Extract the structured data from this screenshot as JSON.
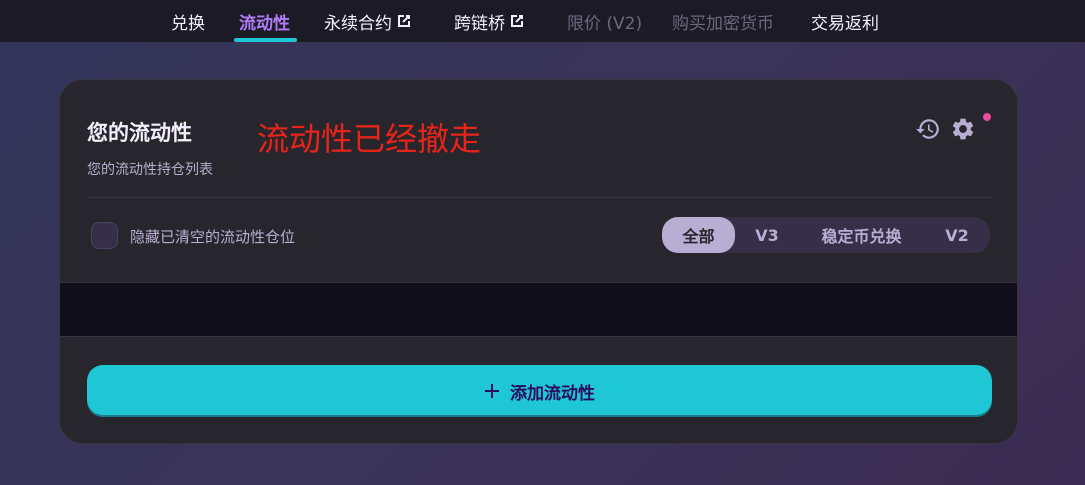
{
  "nav": {
    "items": [
      {
        "label": "兑换",
        "state": "normal",
        "external": false
      },
      {
        "label": "流动性",
        "state": "active",
        "external": false
      },
      {
        "label": "永续合约",
        "state": "normal",
        "external": true
      },
      {
        "label": "跨链桥",
        "state": "normal",
        "external": true
      },
      {
        "label": "限价 (V2)",
        "state": "disabled",
        "external": false
      },
      {
        "label": "购买加密货币",
        "state": "disabled",
        "external": false
      },
      {
        "label": "交易返利",
        "state": "normal",
        "external": false
      }
    ]
  },
  "card": {
    "title": "您的流动性",
    "subtitle": "您的流动性持仓列表",
    "annotation": "流动性已经撤走",
    "hide_closed_label": "隐藏已清空的流动性仓位",
    "filters": [
      {
        "label": "全部",
        "active": true
      },
      {
        "label": "V3",
        "active": false
      },
      {
        "label": "稳定币兑换",
        "active": false
      },
      {
        "label": "V2",
        "active": false
      }
    ],
    "add_button_label": "添加流动性"
  },
  "icons": {
    "history": "history-icon",
    "settings": "gear-icon",
    "external": "external-link-icon",
    "plus": "plus-icon"
  },
  "colors": {
    "accent_primary": "#1fc7d4",
    "accent_secondary": "#b07cf6",
    "notification": "#ed4b9e",
    "annotation": "#e8241a"
  }
}
